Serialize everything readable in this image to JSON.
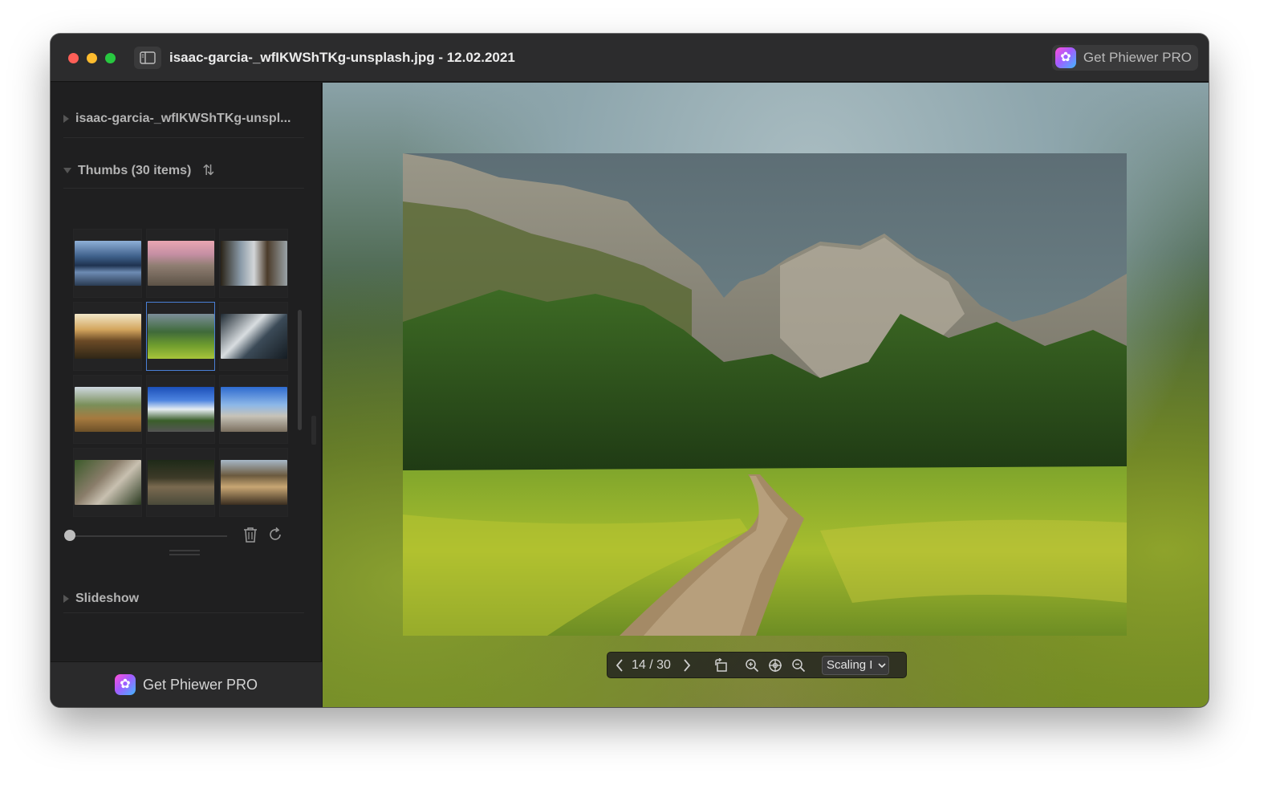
{
  "window": {
    "title": "isaac-garcia-_wfIKWShTKg-unsplash.jpg - 12.02.2021",
    "pro_button_label": "Get Phiewer PRO"
  },
  "sidebar": {
    "file_section_label": "isaac-garcia-_wfIKWShTKg-unspl...",
    "thumbs_section_label": "Thumbs (30 items)",
    "slideshow_section_label": "Slideshow",
    "pro_button_label": "Get Phiewer PRO",
    "thumbnail_count_visible": 12,
    "selected_thumbnail_index": 4,
    "thumbnail_size_slider": 0
  },
  "viewer": {
    "counter": "14 / 30",
    "scaling_select_value": "Scaling I"
  },
  "icons": {
    "sidebar_toggle": "sidebar-toggle-icon",
    "app": "phiewer-app-icon",
    "sort": "sort-icon",
    "trash": "trash-icon",
    "refresh": "refresh-icon",
    "prev": "chevron-left-icon",
    "next": "chevron-right-icon",
    "rotate": "rotate-icon",
    "zoom_in": "zoom-in-icon",
    "zoom_fit": "zoom-fit-icon",
    "zoom_out": "zoom-out-icon"
  },
  "colors": {
    "window_bg": "#1e1e1f",
    "titlebar_bg": "#2c2c2d",
    "selection_border": "#4a7fd6",
    "traffic_red": "#ff5f57",
    "traffic_yellow": "#febc2e",
    "traffic_green": "#28c840"
  }
}
